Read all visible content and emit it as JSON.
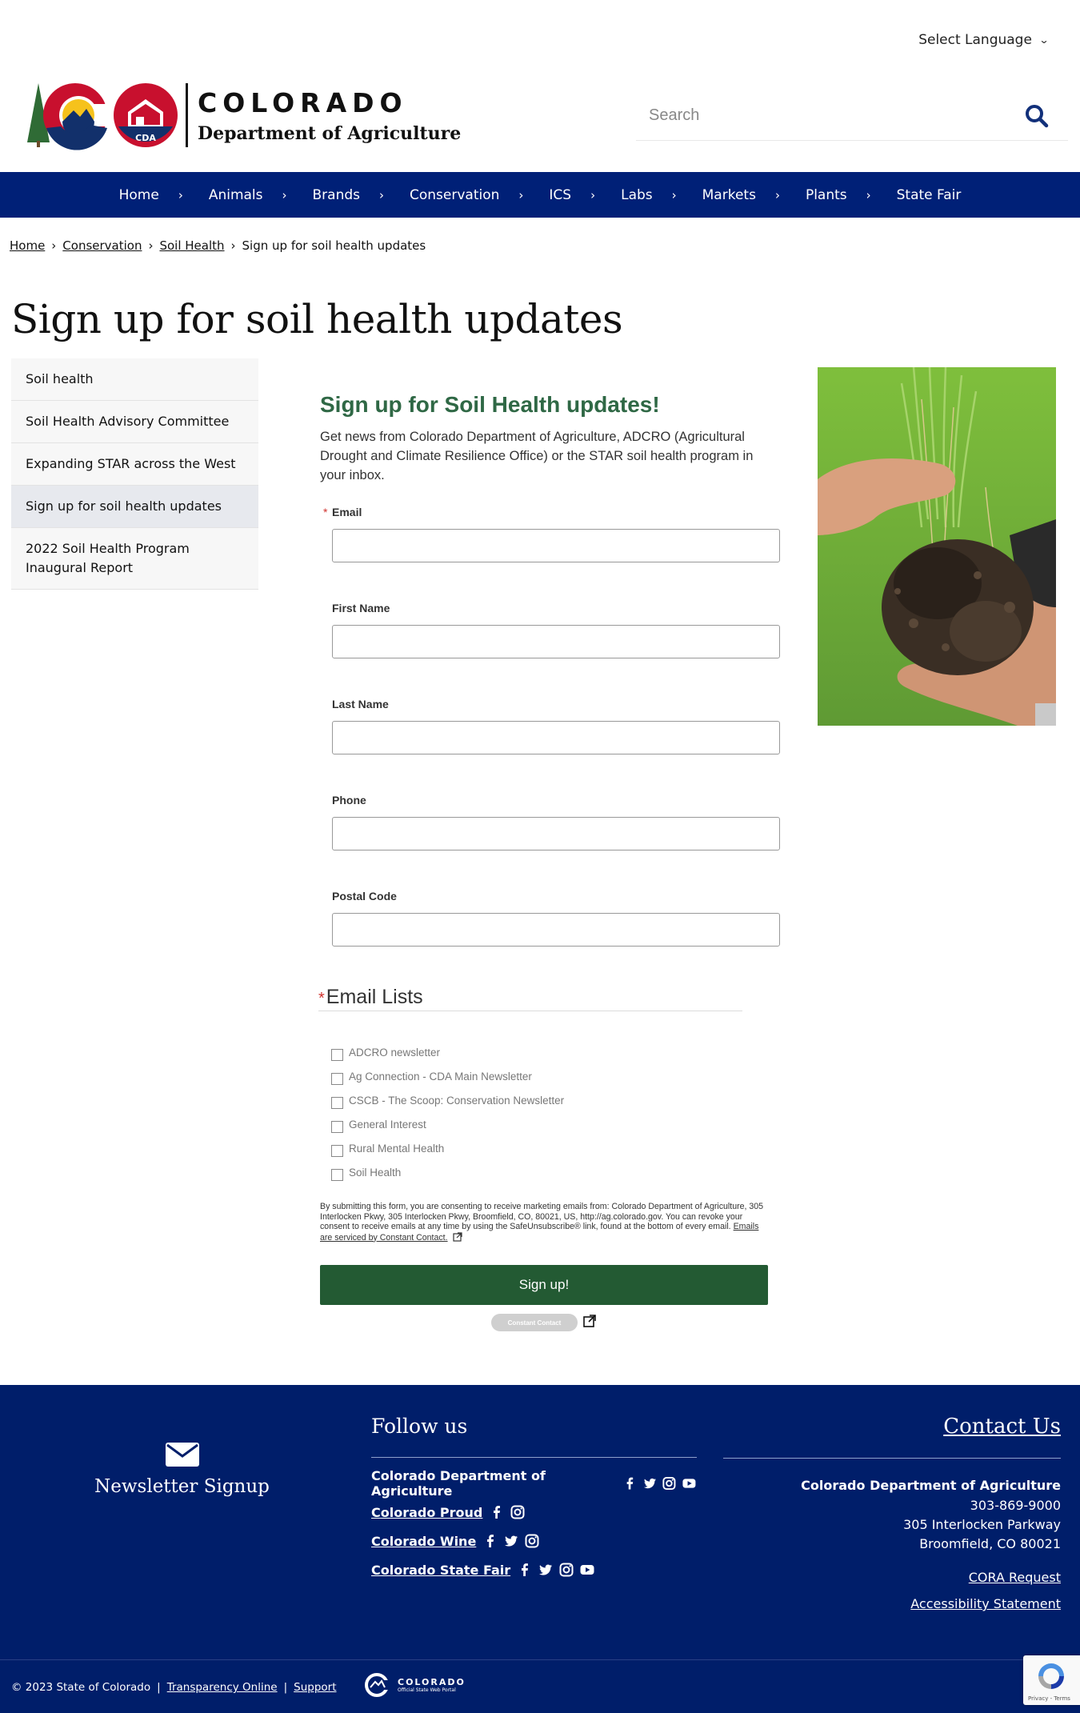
{
  "header": {
    "language_label": "Select Language",
    "logo_title": "COLORADO",
    "logo_subtitle": "Department of Agriculture",
    "logo_badge": "CDA",
    "search_placeholder": "Search"
  },
  "nav": {
    "items": [
      {
        "label": "Home"
      },
      {
        "label": "Animals"
      },
      {
        "label": "Brands"
      },
      {
        "label": "Conservation"
      },
      {
        "label": "ICS"
      },
      {
        "label": "Labs"
      },
      {
        "label": "Markets"
      },
      {
        "label": "Plants"
      },
      {
        "label": "State Fair"
      }
    ],
    "separator": "›"
  },
  "breadcrumb": {
    "items": [
      "Home",
      "Conservation",
      "Soil Health"
    ],
    "current": "Sign up for soil health updates",
    "separator": "›"
  },
  "page_title": "Sign up for soil health updates",
  "sidebar": {
    "items": [
      {
        "label": "Soil health"
      },
      {
        "label": "Soil Health Advisory Committee"
      },
      {
        "label": "Expanding STAR across the West"
      },
      {
        "label": "Sign up for soil health updates"
      },
      {
        "label": "2022 Soil Health Program Inaugural Report"
      }
    ]
  },
  "form": {
    "heading": "Sign up for Soil Health updates!",
    "lead": "Get news from Colorado Department of Agriculture, ADCRO (Agricultural Drought and Climate Resilience Office) or the STAR soil health program in your inbox.",
    "required_mark": "*",
    "fields": [
      {
        "label": "Email",
        "value": ""
      },
      {
        "label": "First Name",
        "value": ""
      },
      {
        "label": "Last Name",
        "value": ""
      },
      {
        "label": "Phone",
        "value": ""
      },
      {
        "label": "Postal Code",
        "value": ""
      }
    ],
    "lists_title": "Email Lists",
    "lists": [
      {
        "label": "ADCRO newsletter"
      },
      {
        "label": "Ag Connection - CDA Main Newsletter"
      },
      {
        "label": "CSCB - The Scoop: Conservation Newsletter"
      },
      {
        "label": "General Interest"
      },
      {
        "label": "Rural Mental Health"
      },
      {
        "label": "Soil Health"
      }
    ],
    "consent_text": "By submitting this form, you are consenting to receive marketing emails from: Colorado Department of Agriculture, 305 Interlocken Pkwy, 305 Interlocken Pkwy, Broomfield, CO, 80021, US, http://ag.colorado.gov. You can revoke your consent to receive emails at any time by using the SafeUnsubscribe® link, found at the bottom of every email.",
    "consent_link": "Emails are serviced by Constant Contact.",
    "submit_label": "Sign up!",
    "cc_badge": "Constant Contact"
  },
  "footer": {
    "newsletter_label": "Newsletter Signup",
    "follow_title": "Follow us",
    "follow_rows": [
      {
        "label": "Colorado Department of Agriculture"
      },
      {
        "label": "Colorado Proud"
      },
      {
        "label": "Colorado Wine"
      },
      {
        "label": "Colorado State Fair"
      }
    ],
    "contact_title": "Contact Us",
    "contact_org": "Colorado Department of Agriculture",
    "contact_phone": "303-869-9000",
    "contact_addr1": "305 Interlocken Parkway",
    "contact_addr2": "Broomfield, CO 80021",
    "cora_link": "CORA Request",
    "accessibility_link": "Accessibility Statement",
    "copyright": "© 2023 State of Colorado",
    "transparency_link": "Transparency Online",
    "support_link": "Support",
    "divider": "|",
    "portal_title": "COLORADO",
    "portal_sub": "Official State Web Portal",
    "recaptcha_text": "Privacy - Terms"
  },
  "colors": {
    "nav_bg": "#002077",
    "footer_bg": "#001e6a",
    "heading_green": "#2f6845",
    "button_green": "#235a33",
    "required_red": "#d0312d"
  }
}
